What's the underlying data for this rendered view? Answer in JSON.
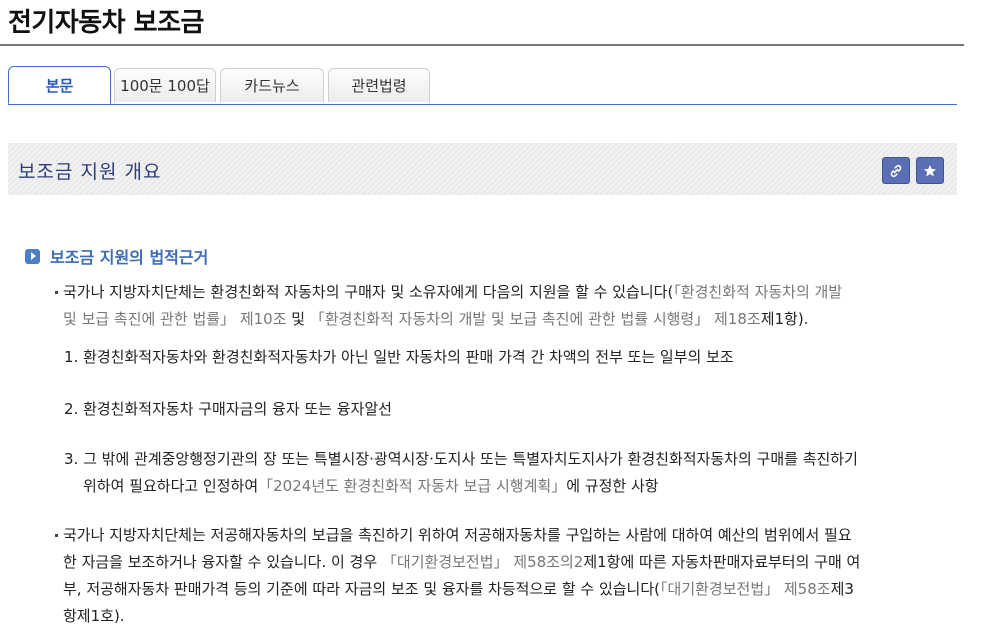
{
  "page": {
    "title": "전기자동차 보조금"
  },
  "tabs": [
    {
      "label": "본문",
      "active": true
    },
    {
      "label": "100문 100답",
      "active": false
    },
    {
      "label": "카드뉴스",
      "active": false
    },
    {
      "label": "관련법령",
      "active": false
    }
  ],
  "section": {
    "title": "보조금 지원 개요",
    "link_icon": "link-icon",
    "star_icon": "star-icon"
  },
  "subsection": {
    "title": "보조금 지원의 법적근거"
  },
  "para1": {
    "a": "국가나 지방자치단체는 환경친화적 자동차의 구매자 및 소유자에게 다음의 지원을 할 수 있습니다(",
    "ref1": "「환경친화적 자동차의 개발",
    "line2_ref1": "및 보급 촉진에 관한 법률」 제10조",
    "b": " 및 ",
    "ref2": "「환경친화적 자동차의 개발 및 보급 촉진에 관한 법률 시행령」 제18조",
    "c": "제1항)."
  },
  "items": {
    "i1": "1. 환경친화적자동차와 환경친화적자동차가 아닌 일반 자동차의 판매 가격 간 차액의 전부 또는 일부의 보조",
    "i2": "2. 환경친화적자동차 구매자금의 융자 또는 융자알선",
    "i3_line1": "3. 그 밖에 관계중앙행정기관의 장 또는 특별시장·광역시장·도지사 또는 특별자치도지사가 환경친화적자동차의 구매를 촉진하기",
    "i3_a": "위하여 필요하다고 인정하여",
    "i3_ref": "「2024년도 환경친화적 자동차 보급 시행계획」",
    "i3_b": "에 규정한 사항"
  },
  "para2": {
    "line1": "국가나 지방자치단체는 저공해자동차의 보급을 촉진하기 위하여 저공해자동차를 구입하는 사람에 대하여 예산의 범위에서 필요",
    "line2_a": "한 자금을 보조하거나 융자할 수 있습니다. 이 경우 ",
    "line2_ref": "「대기환경보전법」 제58조의2",
    "line2_b": "제1항에 따른 자동차판매자료부터의 구매 여",
    "line3_a": "부, 저공해자동차 판매가격 등의 기준에 따라 자금의 보조 및 융자를 차등적으로 할 수 있습니다(",
    "line3_ref": "「대기환경보전법」 제58조",
    "line3_b": "제3",
    "line4": "항제1호)."
  }
}
